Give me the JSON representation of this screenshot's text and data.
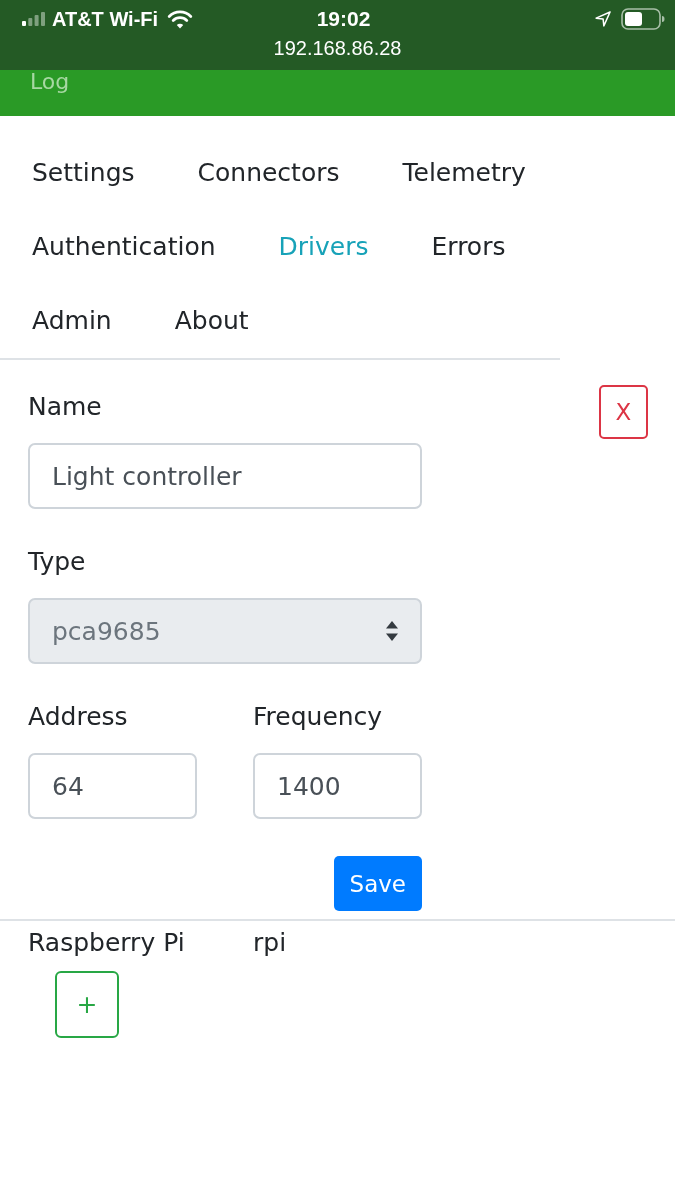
{
  "status_bar": {
    "carrier": "AT&T Wi-Fi",
    "time": "19:02",
    "url": "192.168.86.28"
  },
  "header": {
    "title": "Log"
  },
  "tabs": [
    {
      "label": "Settings",
      "selected": false
    },
    {
      "label": "Connectors",
      "selected": false
    },
    {
      "label": "Telemetry",
      "selected": false
    },
    {
      "label": "Authentication",
      "selected": false
    },
    {
      "label": "Drivers",
      "selected": true
    },
    {
      "label": "Errors",
      "selected": false
    },
    {
      "label": "Admin",
      "selected": false
    },
    {
      "label": "About",
      "selected": false
    }
  ],
  "form": {
    "delete_button": "X",
    "rows": [
      {
        "fields": [
          {
            "kind": "text",
            "label": "Name",
            "value": "Light controller",
            "disabled": false
          }
        ]
      },
      {
        "fields": [
          {
            "kind": "select",
            "label": "Type",
            "value": "pca9685",
            "disabled": true
          }
        ]
      },
      {
        "fields": [
          {
            "kind": "text",
            "label": "Address",
            "value": "64",
            "disabled": false
          },
          {
            "kind": "text",
            "label": "Frequency",
            "value": "1400",
            "disabled": false
          }
        ]
      }
    ],
    "save_button": "Save"
  },
  "drivers": [
    {
      "name": "Raspberry Pi",
      "type": "rpi"
    }
  ],
  "add_button": "+"
}
